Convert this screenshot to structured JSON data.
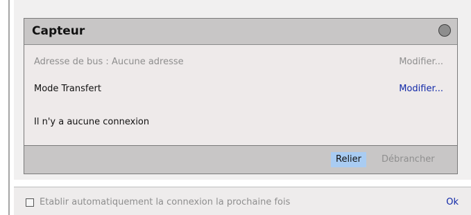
{
  "card": {
    "title": "Capteur",
    "bus_address_text": "Adresse de bus : Aucune adresse",
    "bus_address_action": "Modifier...",
    "mode_text": "Mode Transfert",
    "mode_action": "Modifier...",
    "connection_status": "Il n'y a aucune connexion",
    "status_color": "#8e8e8e"
  },
  "footer": {
    "connect_label": "Relier",
    "disconnect_label": "Débrancher"
  },
  "bottom": {
    "auto_connect_label": "Etablir automatiquement la connexion la prochaine fois",
    "auto_connect_checked": false,
    "ok_label": "Ok"
  },
  "colors": {
    "header_bg": "#c8c6c6",
    "link": "#1028a8",
    "selected_button": "#a9ccf2"
  }
}
